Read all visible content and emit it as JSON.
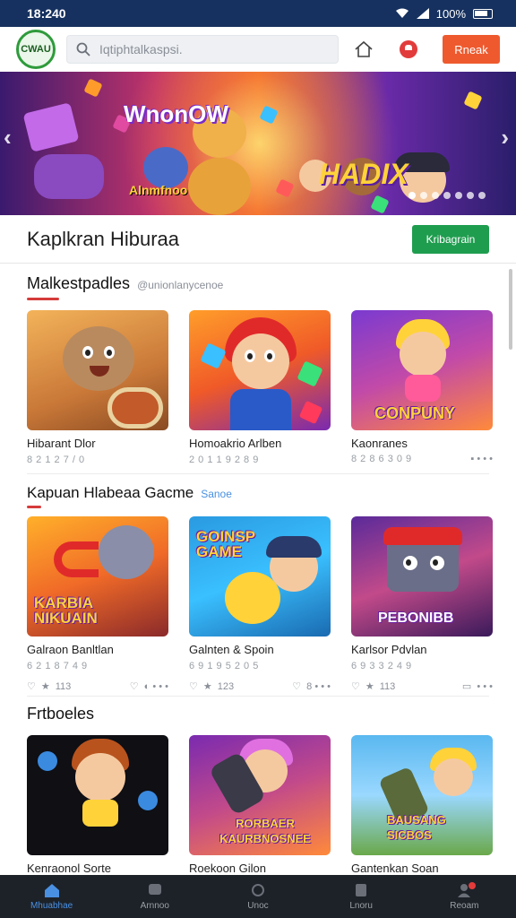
{
  "status_bar": {
    "time": "18:240",
    "battery": "100%"
  },
  "header": {
    "logo_text": "CWAU",
    "search_placeholder": "Iqtiphtalkaspsi.",
    "signin_label": "Rneak"
  },
  "banner": {
    "title": "WnonOW",
    "subtitle": "Alnmfnoo",
    "tag": "HADIX",
    "dot_count": 7,
    "active_dot": 0
  },
  "main": {
    "section_title": "Kaplkran Hiburaa",
    "section_button": "Kribagrain"
  },
  "categories": [
    {
      "title": "Malkestpadles",
      "subtitle": "@unionlanycenoe",
      "games": [
        {
          "title": "Hibarant Dlor",
          "meta": "8 2 1 2 7 / 0",
          "caption": ""
        },
        {
          "title": "Homoakrio Arlben",
          "meta": "2 0 1 1 9 2 8 9",
          "caption": ""
        },
        {
          "title": "Kaonranes",
          "meta": "8 2 8 6 3 0 9",
          "caption": "CONPUNY"
        }
      ]
    },
    {
      "title": "Kapuan Hlabeaa Gacme",
      "subtitle": "Sanoe",
      "games": [
        {
          "title": "Galraon Banltlan",
          "meta": "6 2 1 8 7 4 9",
          "caption": "KARBIA NIKUAIN",
          "likes": "113"
        },
        {
          "title": "Galnten & Spoin",
          "meta": "6 9 1 9 5 2 0 5",
          "caption": "GOINSP GAME",
          "likes": "123"
        },
        {
          "title": "Karlsor Pdvlan",
          "meta": "6 9 3 3 2 4 9",
          "caption": "PEBONIBB",
          "likes": "113"
        }
      ]
    },
    {
      "title": "Frtboeles",
      "subtitle": "",
      "games": [
        {
          "title": "Kenraonol Sorte",
          "caption": ""
        },
        {
          "title": "Roekoon Gilon",
          "caption": "RORBAER KAURBNOSNEE"
        },
        {
          "title": "Gantenkan Soan",
          "caption": "BAUSANG SICBOS"
        }
      ]
    }
  ],
  "bottom_nav": [
    {
      "label": "Mhuabhae",
      "icon": "home-icon",
      "active": true
    },
    {
      "label": "Arnnoo",
      "icon": "chat-icon",
      "active": false
    },
    {
      "label": "Unoc",
      "icon": "refresh-icon",
      "active": false
    },
    {
      "label": "Lnoru",
      "icon": "bookmark-icon",
      "active": false
    },
    {
      "label": "Reoam",
      "icon": "profile-icon",
      "active": false
    }
  ],
  "colors": {
    "accent": "#ee5a2e",
    "green": "#1f9d4f",
    "nav_bg": "#1d2229",
    "status_bg": "#16315f"
  }
}
